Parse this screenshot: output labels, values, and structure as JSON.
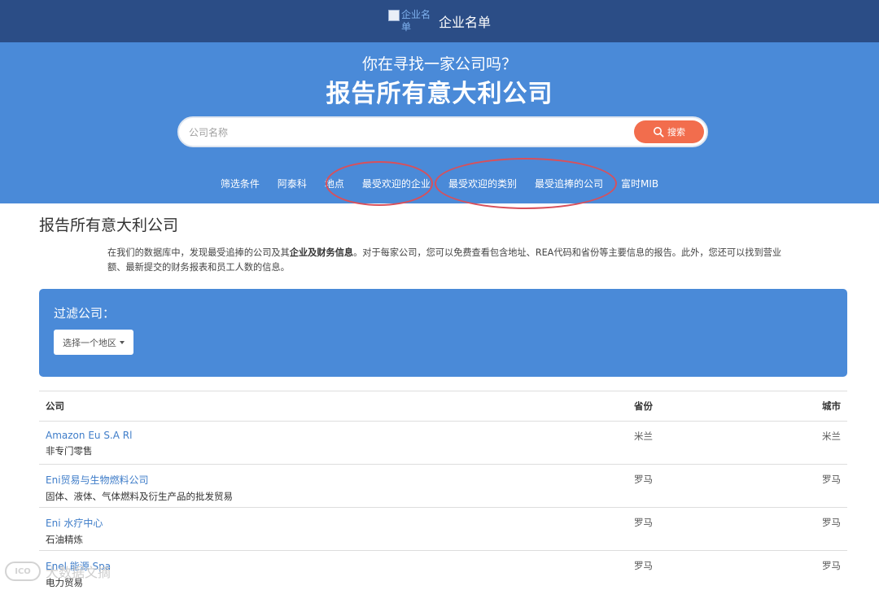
{
  "header": {
    "logo_alt": "企业名单",
    "title": "企业名单",
    "bg_color": "#2b4d86"
  },
  "hero": {
    "subtitle": "你在寻找一家公司吗？",
    "title": "报告所有意大利公司",
    "search_placeholder": "公司名称",
    "search_button": "搜索",
    "search_icon": "search-icon",
    "nav": [
      "筛选条件",
      "阿泰科",
      "地点",
      "最受欢迎的企业",
      "最受欢迎的类别",
      "最受追捧的公司",
      "富时MIB"
    ],
    "bg_color": "#4a8ad8",
    "button_color": "#f26d4d"
  },
  "content": {
    "heading": "报告所有意大利公司",
    "intro_part1": "在我们的数据库中，发现最受追捧的公司及其",
    "intro_bold": "企业及财务信息",
    "intro_part2": "。对于每家公司，您可以免费查看包含地址、REA代码和省份等主要信息的报告。此外，您还可以找到营业额、最新提交的财务报表和员工人数的信息。"
  },
  "filter": {
    "title": "过滤公司：",
    "region_button": "选择一个地区"
  },
  "table": {
    "headers": {
      "company": "公司",
      "province": "省份",
      "city": "城市"
    },
    "rows": [
      {
        "name": "Amazon Eu S.A Rl",
        "category": "非专门零售",
        "province": "米兰",
        "city": "米兰"
      },
      {
        "name": "Eni贸易与生物燃料公司",
        "category": "固体、液体、气体燃料及衍生产品的批发贸易",
        "province": "罗马",
        "city": "罗马"
      },
      {
        "name": "Eni 水疗中心",
        "category": "石油精炼",
        "province": "罗马",
        "city": "罗马"
      },
      {
        "name": "Enel 能源 Spa",
        "category": "电力贸易",
        "province": "罗马",
        "city": "罗马"
      }
    ]
  },
  "watermark": {
    "text": "大数据文摘"
  },
  "annotation_color": "#d8505b"
}
